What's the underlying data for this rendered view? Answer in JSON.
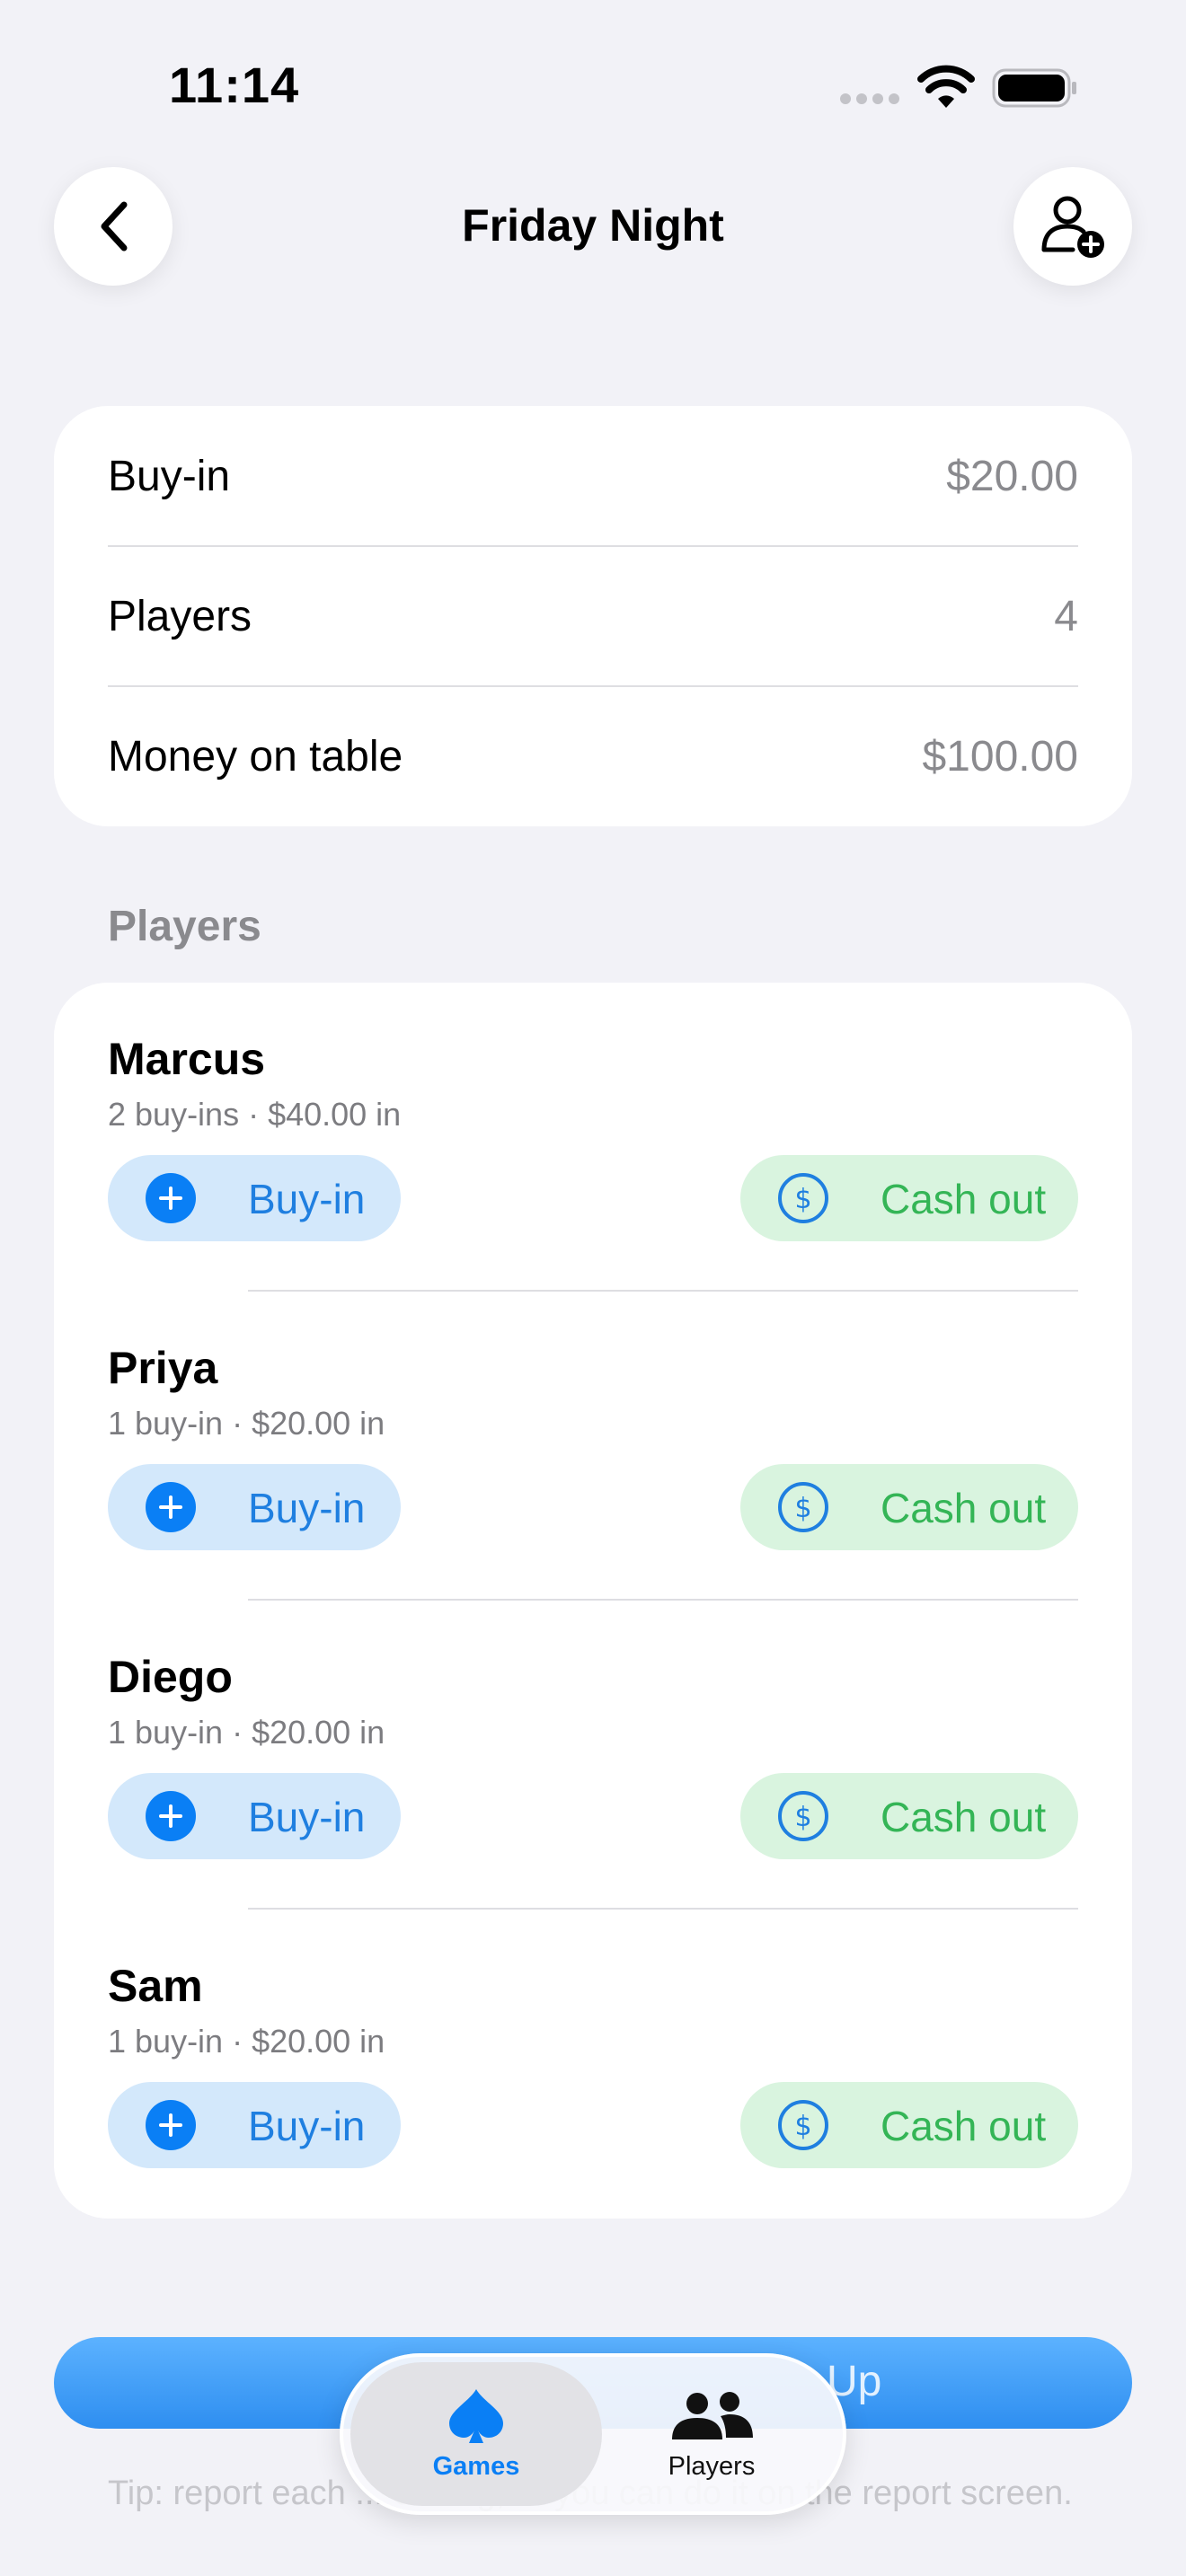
{
  "status_bar": {
    "time": "11:14"
  },
  "nav": {
    "title": "Friday Night"
  },
  "summary": {
    "rows": [
      {
        "label": "Buy-in",
        "value": "$20.00"
      },
      {
        "label": "Players",
        "value": "4"
      },
      {
        "label": "Money on table",
        "value": "$100.00"
      }
    ]
  },
  "players_section": {
    "header": "Players",
    "buyin_label": "Buy-in",
    "cashout_label": "Cash out",
    "players": [
      {
        "name": "Marcus",
        "detail": "2 buy-ins · $40.00 in"
      },
      {
        "name": "Priya",
        "detail": "1 buy-in · $20.00 in"
      },
      {
        "name": "Diego",
        "detail": "1 buy-in · $20.00 in"
      },
      {
        "name": "Sam",
        "detail": "1 buy-in · $20.00 in"
      }
    ]
  },
  "footer": {
    "primary_button_label": "Up",
    "tip": "Tip: report each ... ending, or you can do it on the report screen."
  },
  "tab_bar": {
    "tabs": [
      {
        "label": "Games",
        "icon": "spade-icon",
        "selected": true
      },
      {
        "label": "Players",
        "icon": "people-icon",
        "selected": false
      }
    ]
  },
  "colors": {
    "background": "#f2f2f7",
    "accent_blue": "#0a7ff5",
    "cashout_green": "#34b556",
    "buyin_pill_bg": "#d3e8fb",
    "cashout_pill_bg": "#d9f4df"
  }
}
